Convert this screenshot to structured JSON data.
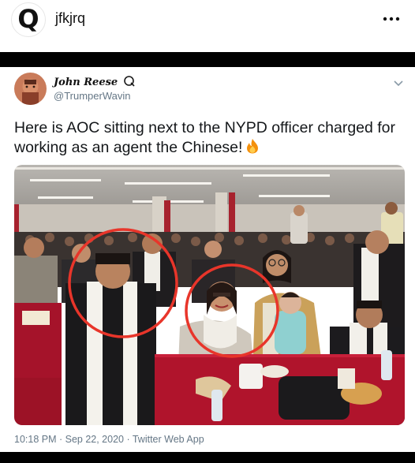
{
  "post": {
    "username": "jfkjrq",
    "logo_letter": "Q",
    "more_icon": "more-horizontal-icon"
  },
  "tweet": {
    "display_name": "John Reese",
    "handle": "@TrumperWavin",
    "text": "Here is AOC sitting next to the NYPD officer charged for working as an agent the Chinese!",
    "emoji": "fire-icon",
    "timestamp": "10:18 PM · Sep 22, 2020 · Twitter Web App"
  },
  "photo": {
    "highlight_color": "#e8352a",
    "tablecloth_color": "#b0142c"
  }
}
